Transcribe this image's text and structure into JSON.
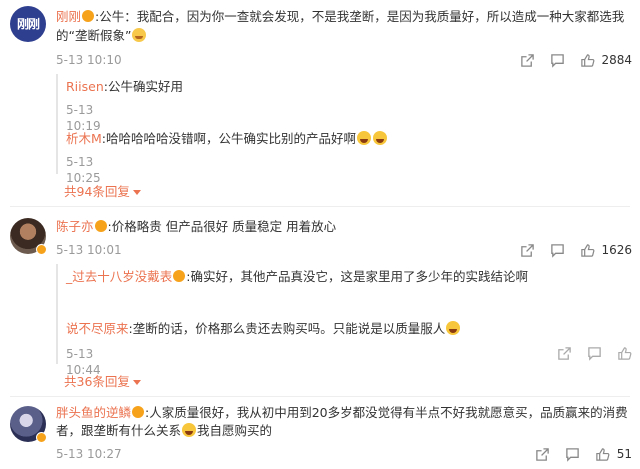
{
  "comments": [
    {
      "user": "刚刚",
      "avatar_text": "刚刚",
      "text_line1_a": ":公牛：我配合，因为你一查就会发现，不是我垄断，是因为我质量好，所以造成一种大家都选我",
      "text_line2": "的“垄断假象”",
      "time": "5-13 10:10",
      "likes": "2884",
      "replies": [
        {
          "user": "Riisen",
          "text": ":公牛确实好用",
          "time": "5-13 10:19"
        },
        {
          "user": "析木M",
          "text": ":哈哈哈哈哈没错啊，公牛确实比别的产品好啊",
          "time": "5-13 10:25"
        }
      ],
      "more": "共94条回复"
    },
    {
      "user": "陈子亦",
      "text": ":价格略贵 但产品很好 质量稳定 用着放心",
      "time": "5-13 10:01",
      "likes": "1626",
      "replies": [
        {
          "user": "_过去十八岁没戴表",
          "text": ":确实好，其他产品真没它，这是家里用了多少年的实践结论啊",
          "time": ""
        },
        {
          "user": "说不尽原来",
          "text": ":垄断的话，价格那么贵还去购买吗。只能说是以质量服人",
          "time": "5-13 10:44"
        }
      ],
      "more": "共36条回复"
    },
    {
      "user": "胖头鱼的逆鳞",
      "text_line1": ":人家质量很好，我从初中用到20多岁都没觉得有半点不好我就愿意买，品质赢来的消费",
      "text_line2_a": "者，跟垄断有什么关系",
      "text_line2_b": "我自愿购买的",
      "time": "5-13 10:27",
      "likes": "51"
    }
  ],
  "icons": [
    "share-icon",
    "comment-icon",
    "like-icon"
  ],
  "colors": {
    "username": "#eb7350",
    "time": "#9a9a9a",
    "badge": "#f7a21b"
  }
}
